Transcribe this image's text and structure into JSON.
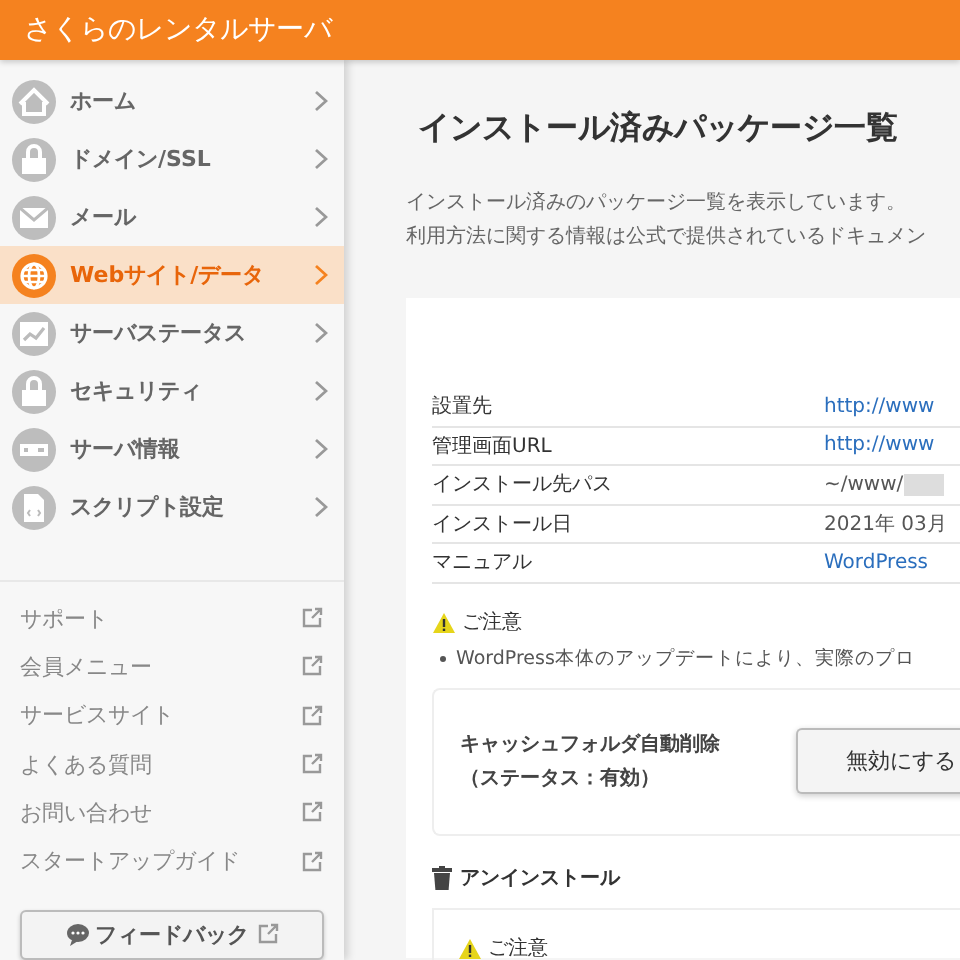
{
  "header": {
    "title": "さくらのレンタルサーバ"
  },
  "nav": [
    {
      "label": "ホーム",
      "selected": false
    },
    {
      "label": "ドメイン/SSL",
      "selected": false
    },
    {
      "label": "メール",
      "selected": false
    },
    {
      "label": "Webサイト/データ",
      "selected": true
    },
    {
      "label": "サーバステータス",
      "selected": false
    },
    {
      "label": "セキュリティ",
      "selected": false
    },
    {
      "label": "サーバ情報",
      "selected": false
    },
    {
      "label": "スクリプト設定",
      "selected": false
    }
  ],
  "links": [
    "サポート",
    "会員メニュー",
    "サービスサイト",
    "よくある質問",
    "お問い合わせ",
    "スタートアップガイド"
  ],
  "feedback_button": "フィードバック",
  "page": {
    "title": "インストール済みパッケージ一覧",
    "description": [
      "インストール済みのパッケージ一覧を表示しています。",
      "利用方法に関する情報は公式で提供されているドキュメン"
    ]
  },
  "details": [
    {
      "label": "設置先",
      "value": "http://www",
      "kind": "link"
    },
    {
      "label": "管理画面URL",
      "value": "http://www",
      "kind": "link"
    },
    {
      "label": "インストール先パス",
      "value": "~/www/",
      "kind": "redacted"
    },
    {
      "label": "インストール日",
      "value": "2021年 03月",
      "kind": "text"
    },
    {
      "label": "マニュアル",
      "value": "WordPress",
      "kind": "link"
    }
  ],
  "notice": {
    "title": "ご注意",
    "items": [
      "WordPress本体のアップデートにより、実際のプロ"
    ]
  },
  "cache": {
    "label": [
      "キャッシュフォルダ自動削除",
      "（ステータス：有効）"
    ],
    "button": "無効にする"
  },
  "uninstall": {
    "title": "アンインストール",
    "notice_title": "ご注意"
  }
}
